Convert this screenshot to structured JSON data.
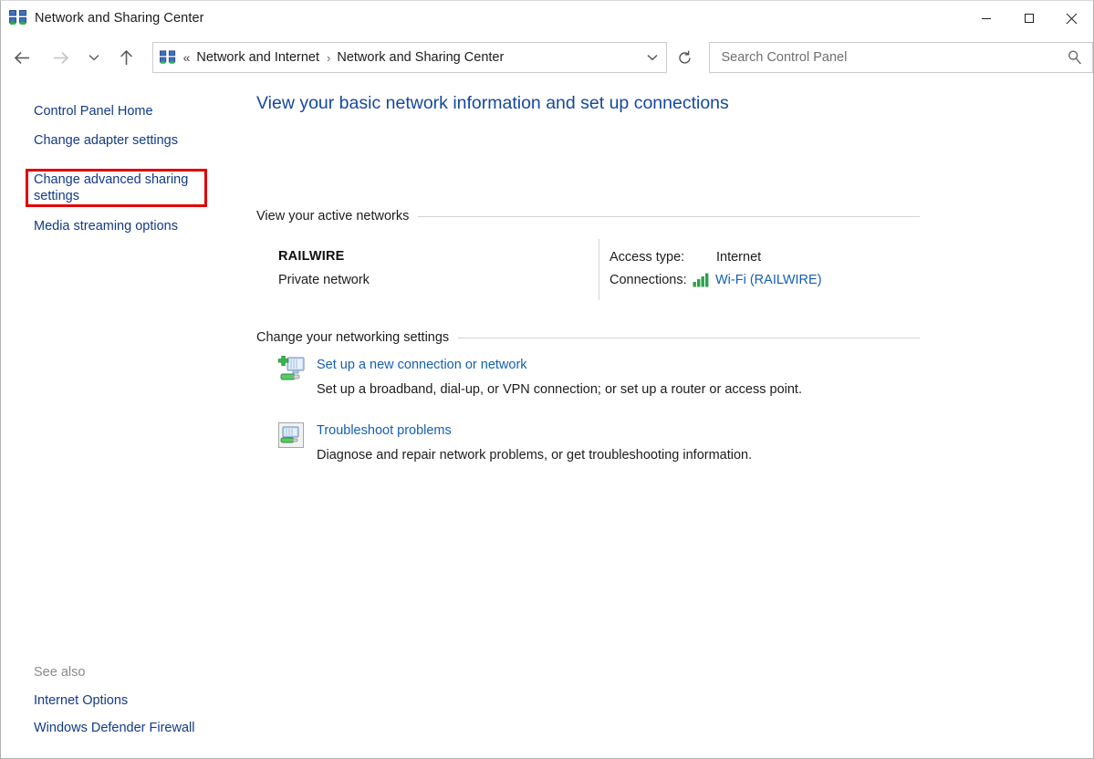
{
  "window": {
    "title": "Network and Sharing Center",
    "title_icon": "network-sharing-icon",
    "controls": {
      "minimize": "minimize-icon",
      "maximize": "maximize-icon",
      "close": "close-icon"
    }
  },
  "nav": {
    "back": "back-arrow-icon",
    "forward": "forward-arrow-icon",
    "recent": "recent-locations-chevron-icon",
    "up": "up-arrow-icon",
    "refresh": "refresh-icon",
    "address": {
      "icon": "network-sharing-icon",
      "overflow": "«",
      "crumb1": "Network and Internet",
      "separator": "›",
      "crumb2": "Network and Sharing Center",
      "dropdown": "chevron-down-icon"
    }
  },
  "search": {
    "placeholder": "Search Control Panel",
    "value": "",
    "icon": "search-icon"
  },
  "sidebar": {
    "items": [
      {
        "label": "Control Panel Home",
        "highlighted": false
      },
      {
        "label": "Change adapter settings",
        "highlighted": false
      },
      {
        "label": "Change advanced sharing settings",
        "highlighted": true
      },
      {
        "label": "Media streaming options",
        "highlighted": false
      }
    ],
    "see_also": {
      "label": "See also",
      "items": [
        {
          "label": "Internet Options"
        },
        {
          "label": "Windows Defender Firewall"
        }
      ]
    }
  },
  "main": {
    "heading": "View your basic network information and set up connections",
    "sections": {
      "active_networks": {
        "title": "View your active networks",
        "network": {
          "name": "RAILWIRE",
          "type": "Private network",
          "access_type_label": "Access type:",
          "access_type_value": "Internet",
          "connections_label": "Connections:",
          "connections_icon": "wifi-signal-bars-icon",
          "connections_value": "Wi-Fi (RAILWIRE)"
        }
      },
      "networking_settings": {
        "title": "Change your networking settings",
        "tasks": [
          {
            "icon": "new-connection-icon",
            "title": "Set up a new connection or network",
            "description": "Set up a broadband, dial-up, or VPN connection; or set up a router or access point."
          },
          {
            "icon": "troubleshoot-icon",
            "title": "Troubleshoot problems",
            "description": "Diagnose and repair network problems, or get troubleshooting information."
          }
        ]
      }
    }
  },
  "colors": {
    "link": "#135fb5",
    "sidebar_link": "#123a87",
    "heading": "#14489e",
    "highlight_border": "#e00000",
    "rule": "#d4d4d4"
  }
}
